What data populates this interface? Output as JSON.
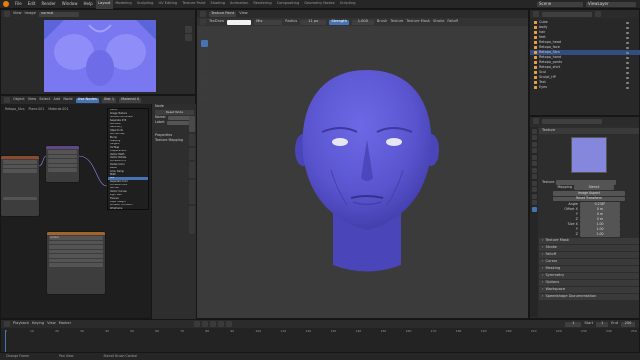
{
  "menu": {
    "items": [
      "File",
      "Edit",
      "Render",
      "Window",
      "Help"
    ],
    "workspaces": [
      "Layout",
      "Modeling",
      "Sculpting",
      "UV Editing",
      "Texture Paint",
      "Shading",
      "Animation",
      "Rendering",
      "Compositing",
      "Geometry Nodes",
      "Scripting"
    ],
    "scene": "Scene",
    "view_layer": "ViewLayer"
  },
  "image_editor": {
    "menus": [
      "View",
      "Image"
    ],
    "image_name": "normal"
  },
  "node_editor": {
    "menus": [
      "Object",
      "View",
      "Select",
      "Add",
      "Node"
    ],
    "use_nodes_label": "Use Nodes",
    "slot": "Slot 1",
    "material": "Material 0",
    "breadcrumb": [
      "Retopo_Stcs",
      "Plane.001",
      "Material.001"
    ],
    "node_node_label": "normal",
    "sidebar": {
      "node_label": "Node",
      "reset_node": "Reset Node",
      "name_label": "Name:",
      "label_label": "Label:",
      "properties_label": "Properties",
      "texture_mapping_label": "Texture Mapping"
    },
    "dropdown_items": [
      "Vector",
      "Image Texture",
      "Texture Coordinate",
      "Separate XYZ",
      "Attribute",
      "Geometry",
      "Object Info",
      "Normal Map",
      "Bump",
      "Mapping",
      "Tangent",
      "UV Map",
      "Displacement",
      "Vector Math",
      "Vector Rotate",
      "Combine XYZ",
      "Vertex Color",
      "Bevel",
      "Color Ramp",
      "Math",
      "Mix",
      "Separate Color",
      "Combine Color",
      "Normal",
      "Vector Curves",
      "Light Path",
      "Fresnel",
      "Layer Weight",
      "Ambient Occlusion",
      "Wireframe"
    ],
    "dropdown_selected": 20,
    "side_tabs": [
      "Node",
      "Tool",
      "View",
      "Options",
      "BlenderKit",
      "Node Wrangler"
    ]
  },
  "viewport": {
    "mode": "Texture Paint",
    "menus": [
      "View"
    ],
    "brush": "TexDraw",
    "blend": "Mix",
    "radius_label": "Radius",
    "radius_value": "11 px",
    "strength_label": "Strength",
    "strength_value": "1.000",
    "header_extra": [
      "Brush",
      "Texture",
      "Texture Mask",
      "Stroke",
      "Falloff"
    ]
  },
  "outliner": {
    "items": [
      {
        "name": "Cube",
        "selected": false
      },
      {
        "name": "body",
        "selected": false
      },
      {
        "name": "hair",
        "selected": false
      },
      {
        "name": "feet",
        "selected": false
      },
      {
        "name": "Retopo_head",
        "selected": false
      },
      {
        "name": "Retopo_face",
        "selected": false
      },
      {
        "name": "Retopo_Stcs",
        "selected": true
      },
      {
        "name": "Retopo_hand",
        "selected": false
      },
      {
        "name": "Retopo_pants",
        "selected": false
      },
      {
        "name": "Retopo_shirt",
        "selected": false
      },
      {
        "name": "Scul",
        "selected": false
      },
      {
        "name": "Sculpt_HP",
        "selected": false
      },
      {
        "name": "Text",
        "selected": false
      },
      {
        "name": "Eyes",
        "selected": false
      }
    ]
  },
  "properties": {
    "texture_label": "Texture",
    "mapping_label": "Mapping",
    "mapping_value": "Stencil",
    "image_aspect": "Image Aspect",
    "reset_transform": "Reset Transform",
    "angle_label": "Angle",
    "angle_value": "0.238°",
    "offset_label": "Offset X",
    "offset_x": "0 m",
    "offset_y": "0 m",
    "offset_z": "0 m",
    "size_label": "Size X",
    "size_x": "1.00",
    "size_y": "1.00",
    "size_z": "1.00",
    "y_label": "Y",
    "z_label": "Z",
    "sections": [
      "Texture Mask",
      "Stroke",
      "Falloff",
      "Cursor",
      "Masking",
      "Symmetry",
      "Options",
      "Workspace",
      "Speedshape Documentation"
    ]
  },
  "timeline": {
    "menus": [
      "Playback",
      "Keying",
      "View",
      "Marker"
    ],
    "current_frame": "1",
    "start_label": "Start",
    "start_value": "1",
    "end_label": "End",
    "end_value": "250",
    "ticks": [
      "0",
      "10",
      "20",
      "30",
      "40",
      "50",
      "60",
      "70",
      "80",
      "90",
      "100",
      "110",
      "120",
      "130",
      "140",
      "150",
      "160",
      "170",
      "180",
      "190",
      "200",
      "210",
      "220",
      "230",
      "240",
      "250"
    ]
  },
  "statusbar": {
    "items": [
      "Change Frame",
      "Pan View",
      "Stencil Brush Control"
    ]
  },
  "colors": {
    "accent": "#4772b3",
    "mesh": "#5a55cf",
    "normal_map": "#7a78f0",
    "orange": "#e87d0d"
  }
}
